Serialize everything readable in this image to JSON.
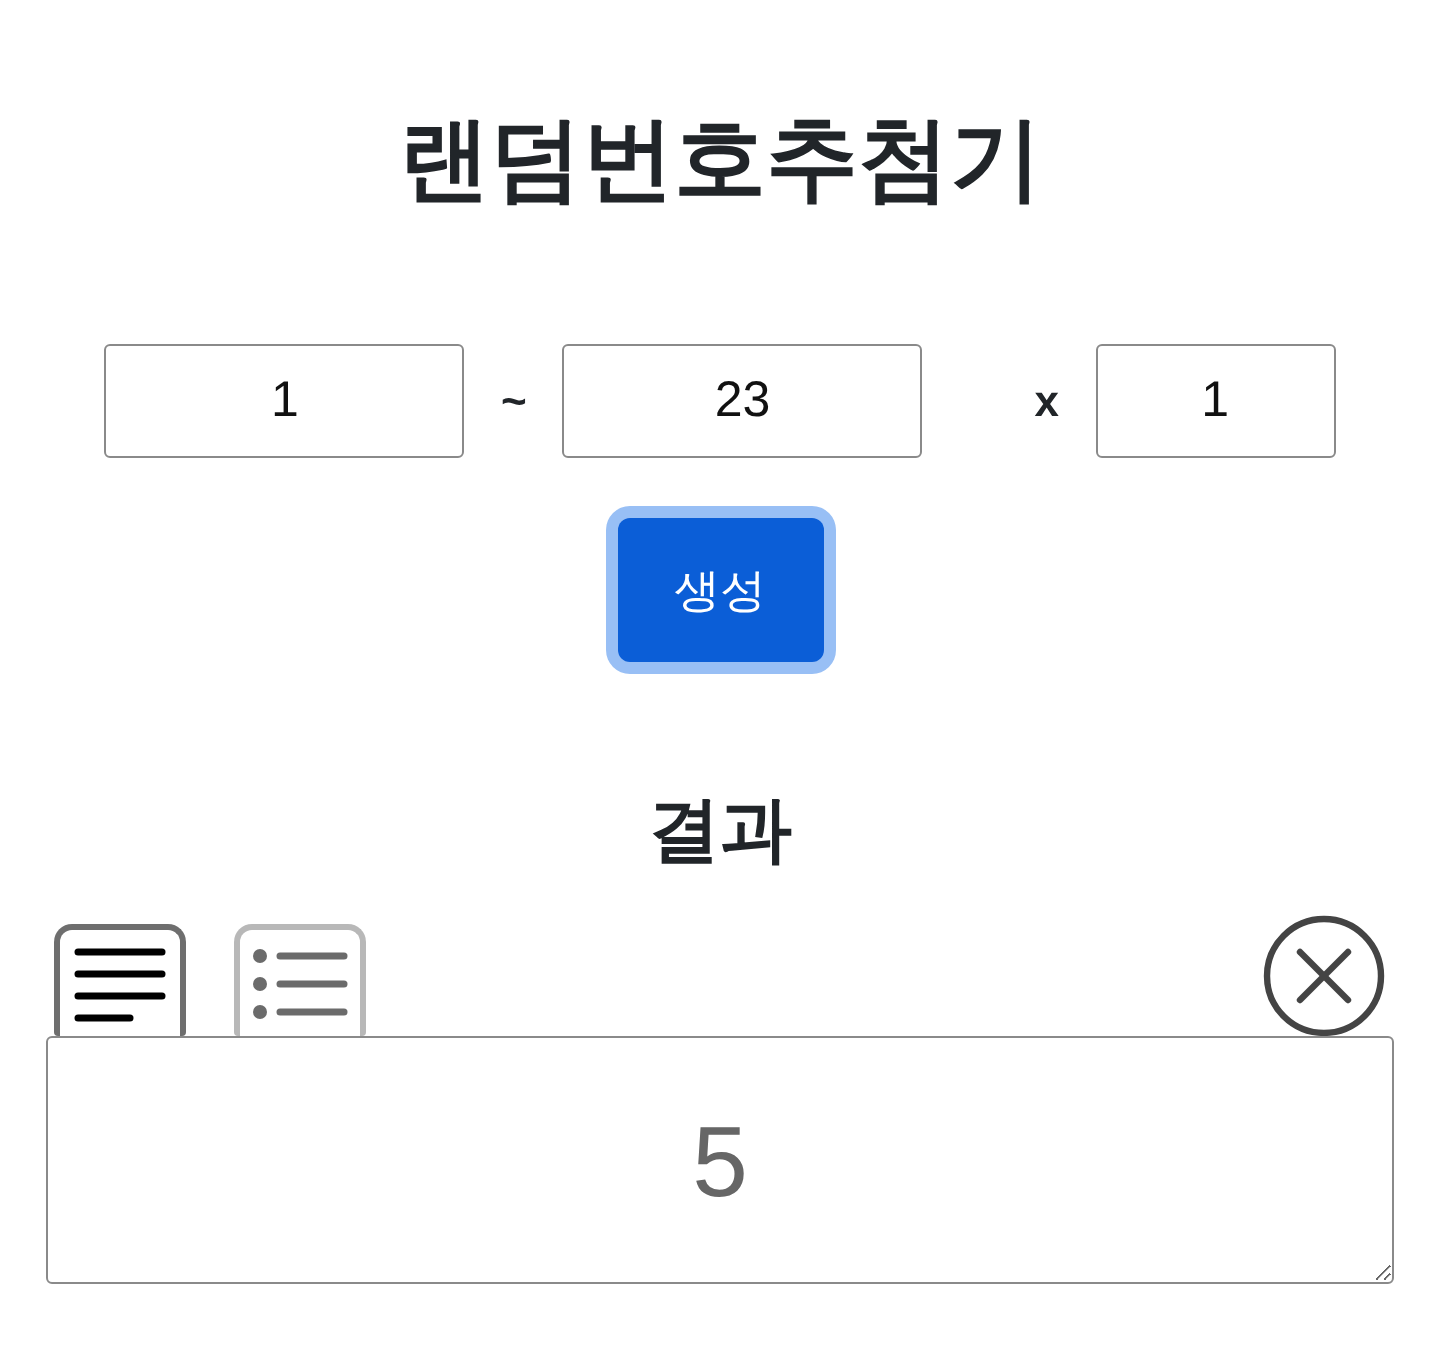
{
  "title": "랜덤번호추첨기",
  "range": {
    "min": "1",
    "separator": "~",
    "max": "23",
    "times_label": "x",
    "count": "1"
  },
  "generate_button": {
    "label": "생성",
    "focused": true
  },
  "result": {
    "heading": "결과",
    "view_modes": [
      {
        "kind": "paragraph",
        "selected": true
      },
      {
        "kind": "list",
        "selected": false
      }
    ],
    "value": "5"
  }
}
